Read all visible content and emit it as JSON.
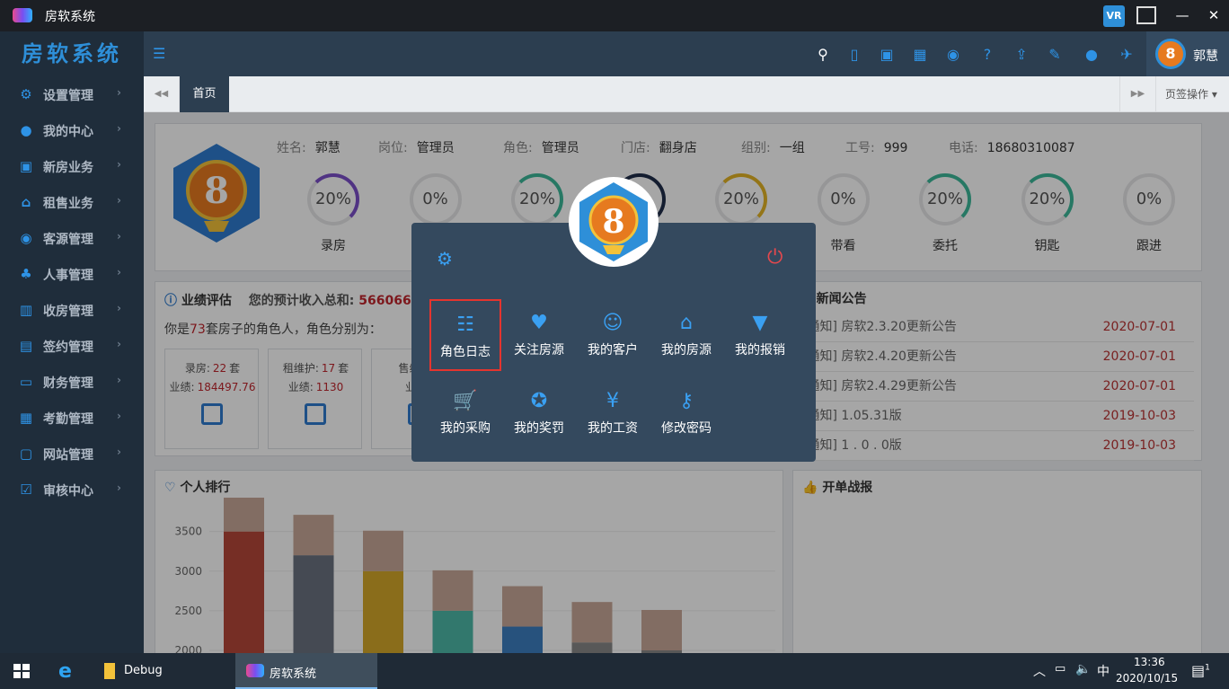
{
  "window": {
    "title": "房软系统",
    "vr_label": "VR",
    "min": "—",
    "max": "☐",
    "close": "✕"
  },
  "brand": "房软系统",
  "header": {
    "username": "郭慧",
    "menu_toggle_icon": "☰"
  },
  "sidebar": {
    "items": [
      {
        "label": "设置管理",
        "icon": "gear-icon",
        "glyph": "⚙"
      },
      {
        "label": "我的中心",
        "icon": "user-icon",
        "glyph": "●"
      },
      {
        "label": "新房业务",
        "icon": "building-icon",
        "glyph": "▣"
      },
      {
        "label": "租售业务",
        "icon": "home-icon",
        "glyph": "⌂"
      },
      {
        "label": "客源管理",
        "icon": "users-icon",
        "glyph": "◉"
      },
      {
        "label": "人事管理",
        "icon": "org-icon",
        "glyph": "♣"
      },
      {
        "label": "收房管理",
        "icon": "house-icon",
        "glyph": "▥"
      },
      {
        "label": "签约管理",
        "icon": "contract-icon",
        "glyph": "▤"
      },
      {
        "label": "财务管理",
        "icon": "wallet-icon",
        "glyph": "▭"
      },
      {
        "label": "考勤管理",
        "icon": "chart-icon",
        "glyph": "▦"
      },
      {
        "label": "网站管理",
        "icon": "monitor-icon",
        "glyph": "▢"
      },
      {
        "label": "审核中心",
        "icon": "check-icon",
        "glyph": "☑"
      }
    ],
    "chevron": "›"
  },
  "tabs": {
    "prev": "◀◀",
    "home": "首页",
    "next": "▶▶",
    "page_ops": "页签操作"
  },
  "profile": {
    "avatar_number": "8",
    "fields": [
      {
        "k": "姓名:",
        "v": "郭慧"
      },
      {
        "k": "岗位:",
        "v": "管理员"
      },
      {
        "k": "角色:",
        "v": "管理员"
      },
      {
        "k": "门店:",
        "v": "翻身店"
      },
      {
        "k": "组别:",
        "v": "一组"
      },
      {
        "k": "工号:",
        "v": "999"
      },
      {
        "k": "电话:",
        "v": "18680310087"
      }
    ],
    "rings": [
      {
        "pct": "20%",
        "label": "录房",
        "color": "#7b4fc9"
      },
      {
        "pct": "0%",
        "label": "",
        "color": "#e6e7e9"
      },
      {
        "pct": "20%",
        "label": "",
        "color": "#3cb89a"
      },
      {
        "pct": "",
        "label": "",
        "color": "#1f2d4a"
      },
      {
        "pct": "20%",
        "label": "",
        "color": "#e3b425"
      },
      {
        "pct": "0%",
        "label": "带看",
        "color": "#e6e7e9"
      },
      {
        "pct": "20%",
        "label": "委托",
        "color": "#3cb89a"
      },
      {
        "pct": "20%",
        "label": "钥匙",
        "color": "#3cb89a"
      },
      {
        "pct": "0%",
        "label": "跟进",
        "color": "#e6e7e9"
      }
    ]
  },
  "performance": {
    "title": "业绩评估",
    "subtitle": "您的预计收入总和:",
    "amount": "566066",
    "desc_prefix": "你是",
    "desc_count": "73",
    "desc_suffix": "套房子的角色人，角色分别为：",
    "cards": [
      {
        "l1k": "录房:",
        "l1v": "22",
        "l1u": "套",
        "l2k": "业绩:",
        "l2v": "184497.76"
      },
      {
        "l1k": "租维护:",
        "l1v": "17",
        "l1u": "套",
        "l2k": "业绩:",
        "l2v": "1130"
      },
      {
        "l1k": "售维护:",
        "l1v": "",
        "l1u": "",
        "l2k": "业绩:",
        "l2v": ""
      }
    ]
  },
  "news": {
    "title": "新闻公告",
    "rows": [
      {
        "t": "[通知] 房软2.3.20更新公告",
        "d": "2020-07-01"
      },
      {
        "t": "[通知] 房软2.4.20更新公告",
        "d": "2020-07-01"
      },
      {
        "t": "[通知] 房软2.4.29更新公告",
        "d": "2020-07-01"
      },
      {
        "t": "[通知] 1.05.31版",
        "d": "2019-10-03"
      },
      {
        "t": "[通知] 1 . 0 . 0版",
        "d": "2019-10-03"
      }
    ]
  },
  "ranking": {
    "title": "个人排行"
  },
  "kaidan": {
    "title": "开单战报"
  },
  "chart_data": {
    "type": "bar",
    "title": "",
    "yticks": [
      "3500",
      "3000",
      "2500",
      "2000"
    ],
    "ylim": [
      2000,
      3700
    ],
    "values": [
      3500,
      3200,
      3000,
      2500,
      2300,
      2100,
      2000
    ],
    "colors": [
      "#b5473a",
      "#6b7280",
      "#d4a82a",
      "#4db8a8",
      "#3c7fc0",
      "#888",
      "#888"
    ]
  },
  "popup": {
    "avatar_number": "8",
    "items": [
      {
        "label": "角色日志",
        "glyph": "☷",
        "icon": "role-log-icon",
        "selected": true
      },
      {
        "label": "关注房源",
        "glyph": "♥",
        "icon": "heart-icon"
      },
      {
        "label": "我的客户",
        "glyph": "☺",
        "icon": "customers-icon"
      },
      {
        "label": "我的房源",
        "glyph": "⌂",
        "icon": "house-icon"
      },
      {
        "label": "我的报销",
        "glyph": "▼",
        "icon": "reimburse-icon"
      },
      {
        "label": "我的采购",
        "glyph": "🛒",
        "icon": "cart-icon"
      },
      {
        "label": "我的奖罚",
        "glyph": "✪",
        "icon": "award-icon"
      },
      {
        "label": "我的工资",
        "glyph": "¥",
        "icon": "yen-icon"
      },
      {
        "label": "修改密码",
        "glyph": "⚷",
        "icon": "key-icon"
      }
    ],
    "settings_glyph": "⚙",
    "power_glyph": "⏻"
  },
  "taskbar": {
    "tasks": [
      {
        "label": "Debug"
      },
      {
        "label": "房软系统"
      }
    ],
    "ime": "中",
    "time": "13:36",
    "date": "2020/10/15",
    "notif_count": "1"
  }
}
